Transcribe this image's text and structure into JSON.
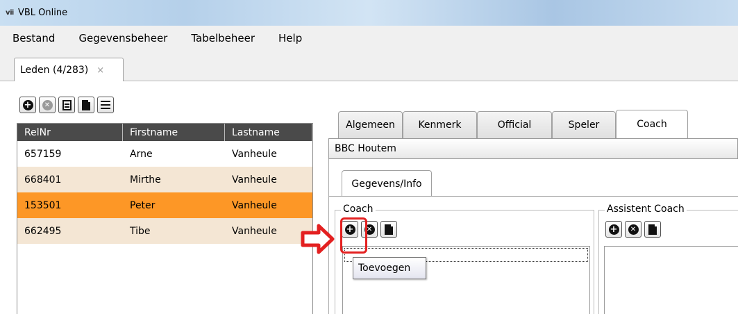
{
  "window": {
    "title": "VBL Online",
    "app_icon": "app-logo-icon"
  },
  "menu": {
    "items": [
      "Bestand",
      "Gegevensbeheer",
      "Tabelbeheer",
      "Help"
    ]
  },
  "document_tab": {
    "label": "Leden (4/283)",
    "close_glyph": "×"
  },
  "toolbar": {
    "icons": [
      "add-icon",
      "delete-icon",
      "form-icon",
      "document-icon",
      "list-icon"
    ]
  },
  "grid": {
    "columns": [
      "RelNr",
      "Firstname",
      "Lastname"
    ],
    "rows": [
      {
        "relnr": "657159",
        "firstname": "Arne",
        "lastname": "Vanheule"
      },
      {
        "relnr": "668401",
        "firstname": "Mirthe",
        "lastname": "Vanheule"
      },
      {
        "relnr": "153501",
        "firstname": "Peter",
        "lastname": "Vanheule"
      },
      {
        "relnr": "662495",
        "firstname": "Tibe",
        "lastname": "Vanheule"
      }
    ],
    "selected_row": 2
  },
  "detail_tabs": [
    "Algemeen",
    "Kenmerk",
    "Official",
    "Speler",
    "Coach"
  ],
  "active_detail_tab": "Coach",
  "club": {
    "name": "BBC Houtem"
  },
  "subtab": {
    "label": "Gegevens/Info"
  },
  "coach_group": {
    "title": "Coach"
  },
  "assistant_group": {
    "title": "Assistent Coach"
  },
  "tooltip": {
    "text": "Toevoegen"
  },
  "colors": {
    "selected_row": "#fd9726",
    "alt_row": "#f4e6d4",
    "header": "#4a4a4a",
    "annotation": "#e32020"
  }
}
